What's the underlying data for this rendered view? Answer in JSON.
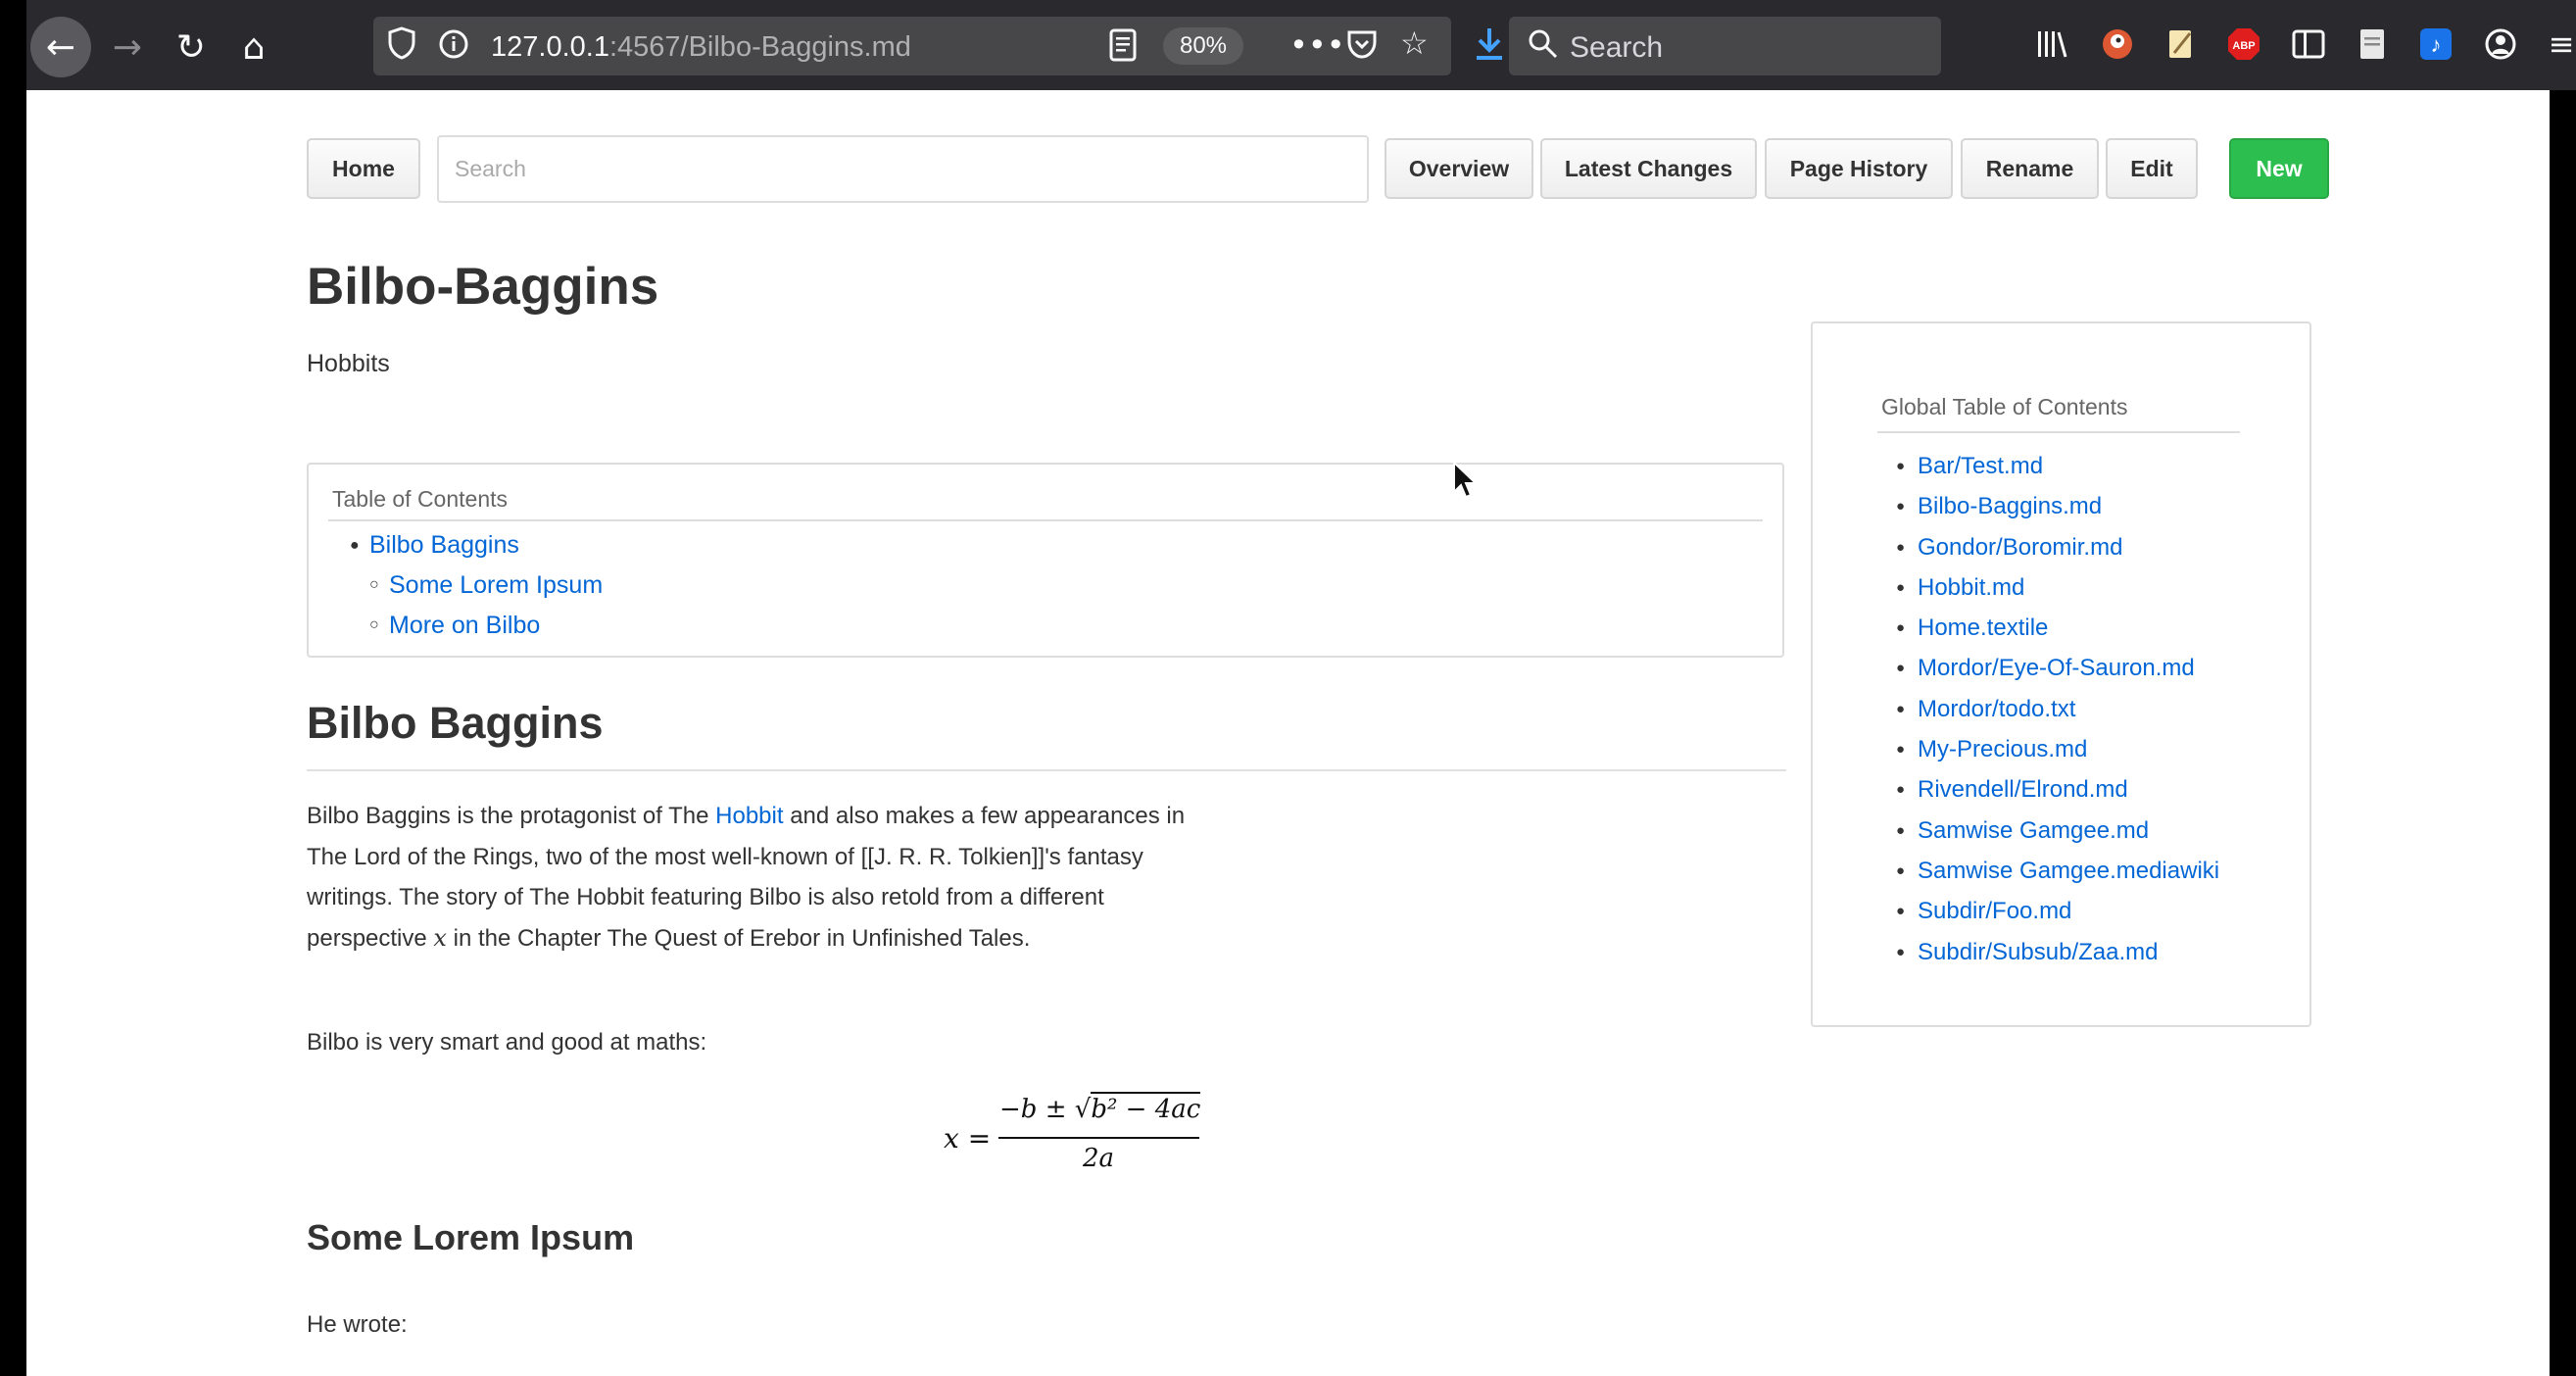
{
  "browser": {
    "url_host": "127.0.0.1",
    "url_path": ":4567/Bilbo-Baggins.md",
    "zoom": "80%",
    "search_placeholder": "Search"
  },
  "toolbar": {
    "home_label": "Home",
    "search_placeholder": "Search",
    "overview_label": "Overview",
    "latest_changes_label": "Latest Changes",
    "page_history_label": "Page History",
    "rename_label": "Rename",
    "edit_label": "Edit",
    "new_label": "New"
  },
  "page": {
    "title": "Bilbo-Baggins",
    "subtitle": "Hobbits"
  },
  "toc": {
    "title": "Table of Contents",
    "items": [
      "Bilbo Baggins",
      "Some Lorem Ipsum",
      "More on Bilbo"
    ]
  },
  "article": {
    "heading": "Bilbo Baggins",
    "para1_a": "Bilbo Baggins is the protagonist of The ",
    "para1_link": "Hobbit",
    "para1_b": " and also makes a few appearances in The Lord of the Rings, two of the most well-known of [[J. R. R. Tolkien]]'s fantasy writings. The story of The Hobbit featuring Bilbo is also retold from a different perspective ",
    "para1_var": "x",
    "para1_c": " in the Chapter The Quest of Erebor in Unfinished Tales.",
    "para2": "Bilbo is very smart and good at maths:",
    "formula": {
      "lhs": "x =",
      "numerator": "−b ± √",
      "radicand": "b² − 4ac",
      "denominator": "2a"
    },
    "section2_heading": "Some Lorem Ipsum",
    "section2_text": "He wrote:"
  },
  "global_toc": {
    "title": "Global Table of Contents",
    "items": [
      "Bar/Test.md",
      "Bilbo-Baggins.md",
      "Gondor/Boromir.md",
      "Hobbit.md",
      "Home.textile",
      "Mordor/Eye-Of-Sauron.md",
      "Mordor/todo.txt",
      "My-Precious.md",
      "Rivendell/Elrond.md",
      "Samwise Gamgee.md",
      "Samwise Gamgee.mediawiki",
      "Subdir/Foo.md",
      "Subdir/Subsub/Zaa.md"
    ]
  },
  "colors": {
    "link": "#0366d6",
    "new_button": "#2cbe4e",
    "chrome_bg": "#2a2a2e"
  }
}
